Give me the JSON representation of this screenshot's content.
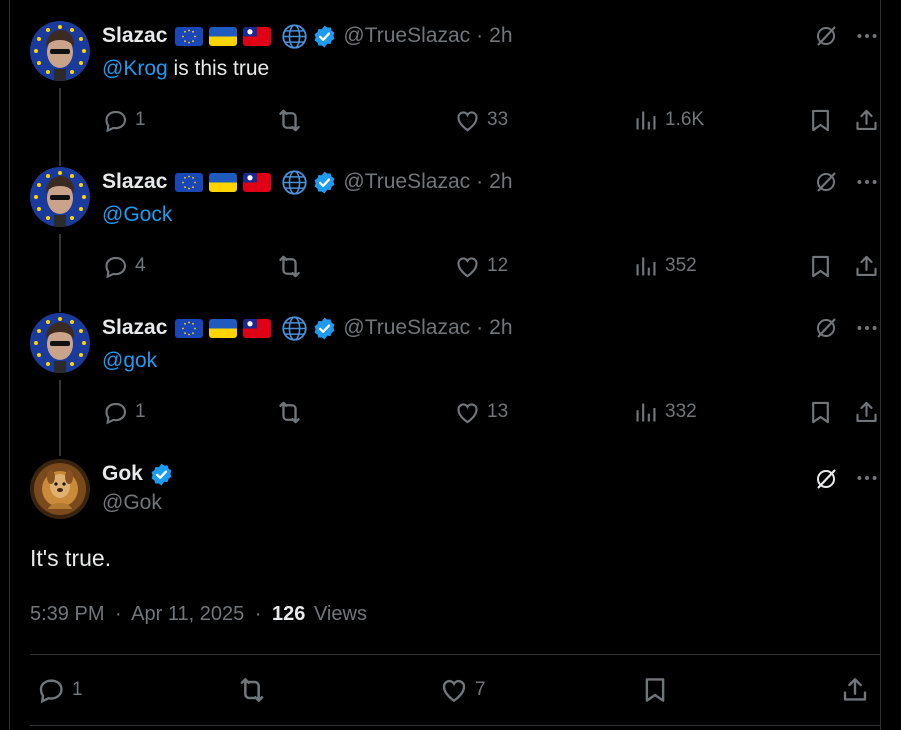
{
  "tweets": [
    {
      "name": "Slazac",
      "handle": "@TrueSlazac",
      "time": "2h",
      "mention": "@Krog",
      "text": " is this true",
      "replies": "1",
      "likes": "33",
      "views": "1.6K"
    },
    {
      "name": "Slazac",
      "handle": "@TrueSlazac",
      "time": "2h",
      "mention": "@Gock",
      "text": "",
      "replies": "4",
      "likes": "12",
      "views": "352"
    },
    {
      "name": "Slazac",
      "handle": "@TrueSlazac",
      "time": "2h",
      "mention": "@gok",
      "text": "",
      "replies": "1",
      "likes": "13",
      "views": "332"
    }
  ],
  "main": {
    "name": "Gok",
    "handle": "@Gok",
    "text": "It's true.",
    "time": "5:39 PM",
    "date": "Apr 11, 2025",
    "views_count": "126",
    "views_label": "Views",
    "replies": "1",
    "likes": "7",
    "separator": "·"
  },
  "colors": {
    "accent": "#1d9bf0",
    "muted": "#71767b",
    "text": "#e7e9ea",
    "background": "#000000"
  },
  "icons": [
    "reply-icon",
    "retweet-icon",
    "like-icon",
    "views-icon",
    "bookmark-icon",
    "share-icon",
    "grok-icon",
    "more-icon",
    "verified-icon",
    "globe-icon"
  ]
}
